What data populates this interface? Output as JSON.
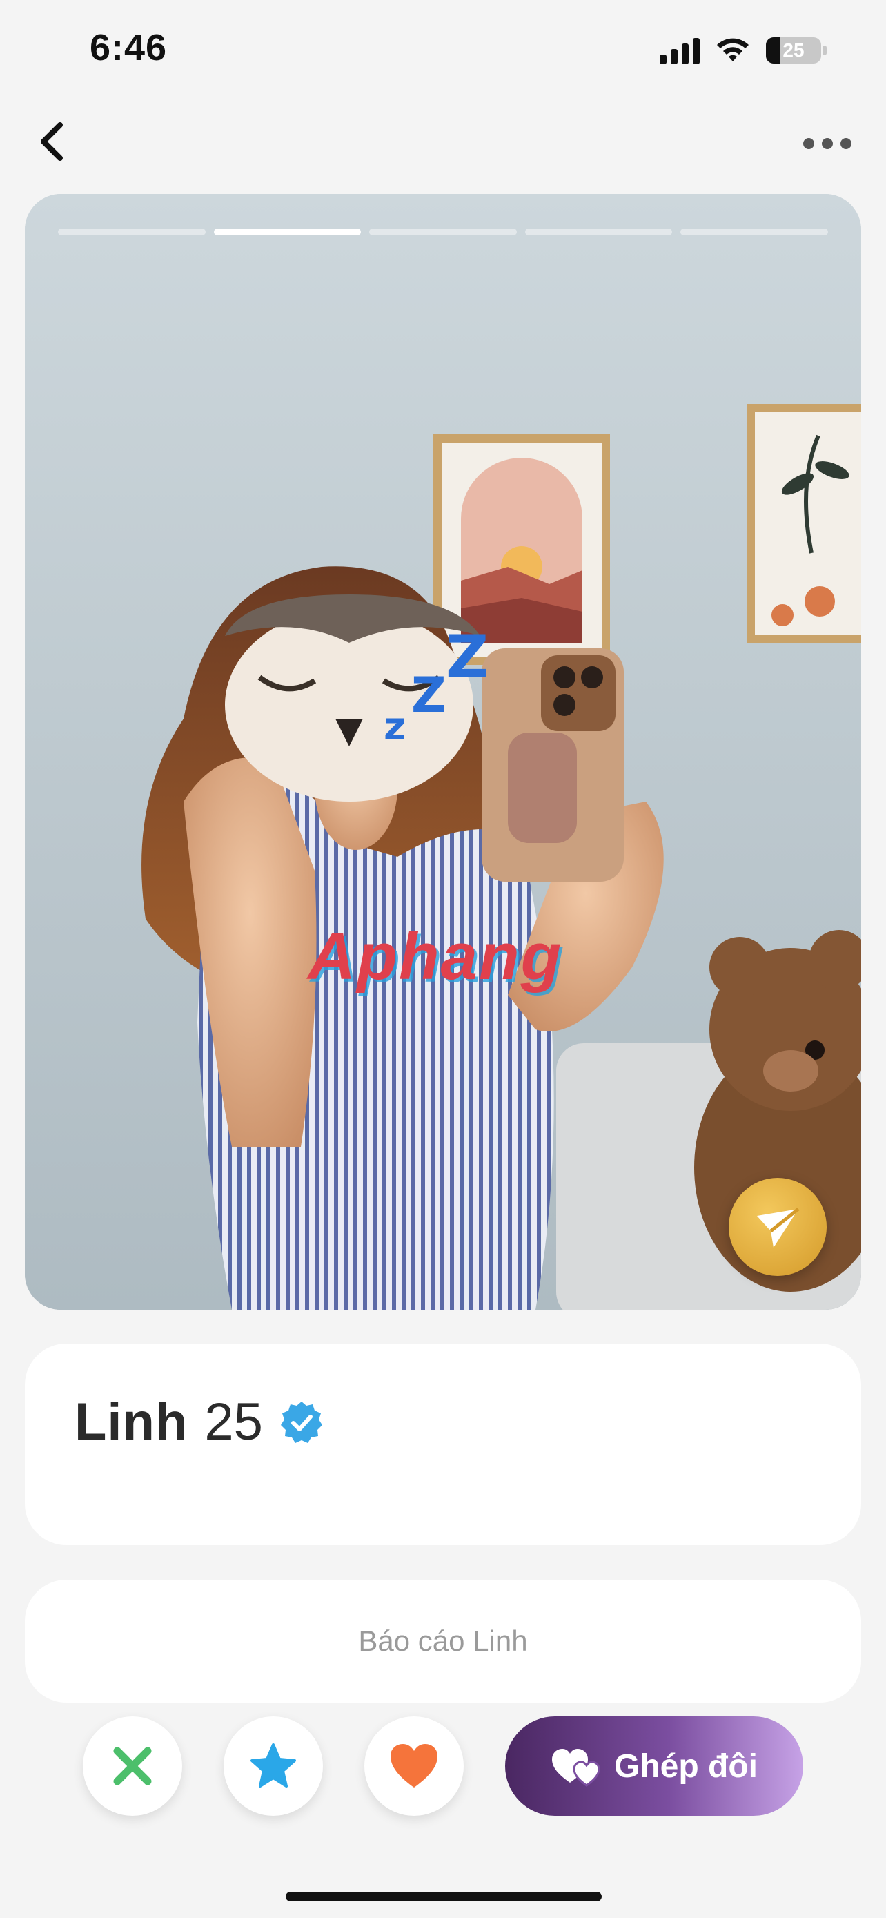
{
  "status_bar": {
    "time": "6:46",
    "battery": "25",
    "icons": [
      "cellular-signal-icon",
      "wifi-icon",
      "battery-icon"
    ]
  },
  "nav": {
    "back_icon": "chevron-left-icon",
    "more_icon": "more-dots-icon"
  },
  "photo": {
    "progress": {
      "total": 5,
      "current": 2
    },
    "watermark": "Aphang",
    "superlike_icon": "paper-plane-icon"
  },
  "profile": {
    "name": "Linh",
    "age": "25",
    "verified_icon": "verified-badge-icon"
  },
  "report": {
    "label": "Báo cáo Linh"
  },
  "actions": {
    "nope_icon": "x-icon",
    "super_like_icon": "star-icon",
    "like_icon": "heart-icon",
    "match_label": "Ghép đôi",
    "match_icon": "hearts-icon"
  },
  "colors": {
    "nope": "#4cbf6b",
    "star": "#2aa7e8",
    "like": "#f5743b",
    "match_gradient_start": "#4a2762",
    "match_gradient_end": "#c6a2e6",
    "verified": "#3aa7e6"
  }
}
